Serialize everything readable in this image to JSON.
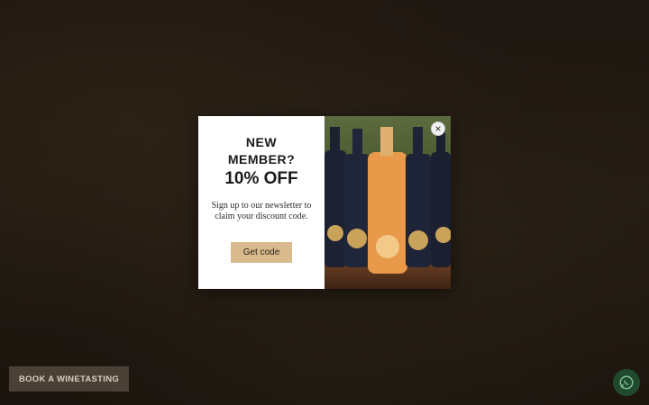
{
  "popup": {
    "headline_line1": "NEW",
    "headline_line2": "MEMBER?",
    "headline_offer": "10% OFF",
    "description": "Sign up to our newsletter to claim your discount code.",
    "cta_label": "Get code",
    "close_label": "×",
    "image_alt": "Can Gelat wine bottles"
  },
  "footer": {
    "book_button_label": "BOOK A WINETASTING"
  },
  "icons": {
    "close": "close-icon",
    "whatsapp": "whatsapp-icon"
  },
  "colors": {
    "cta_background": "#d8ba8c",
    "book_button_background": "#4a4036",
    "whatsapp_background": "#1f4a2e"
  }
}
